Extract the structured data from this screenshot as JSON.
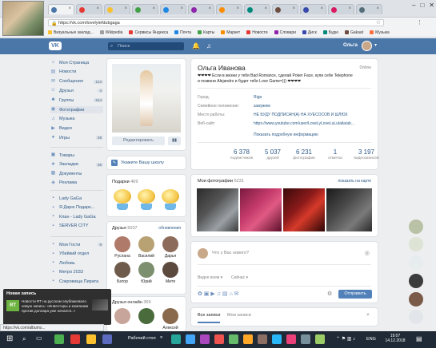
{
  "browser": {
    "tabs": [
      {
        "label": "",
        "color": "#4a76a8",
        "active": true
      },
      {
        "label": "",
        "color": "#e53935"
      },
      {
        "label": "",
        "color": "#fbc02d"
      },
      {
        "label": "",
        "color": "#43a047"
      },
      {
        "label": "",
        "color": "#1e88e5"
      },
      {
        "label": "",
        "color": "#8e24aa"
      },
      {
        "label": "",
        "color": "#fb8c00"
      },
      {
        "label": "",
        "color": "#00897b"
      },
      {
        "label": "",
        "color": "#6d4c41"
      },
      {
        "label": "",
        "color": "#3949ab"
      },
      {
        "label": "",
        "color": "#d81b60"
      },
      {
        "label": "",
        "color": "#546e7a"
      }
    ],
    "url": "https://vk.com/lovelylefdubgaga",
    "bookmarks": [
      "Визуальные заклад...",
      "Wikipedia",
      "Сервисы Яндекса",
      "Почта",
      "Карты",
      "Маркет",
      "Новости",
      "Словари",
      "Диск",
      "Будю",
      "Gakaat",
      "Музыка"
    ]
  },
  "vk": {
    "logo": "VK",
    "search_placeholder": "Поиск",
    "user_name": "Ольга",
    "menu": [
      {
        "label": "Моя Страница",
        "icon": "home-icon"
      },
      {
        "label": "Новости",
        "icon": "news-icon"
      },
      {
        "label": "Сообщения",
        "icon": "message-icon",
        "count": "144"
      },
      {
        "label": "Друзья",
        "icon": "friends-icon",
        "count": "4"
      },
      {
        "label": "Группы",
        "icon": "groups-icon",
        "count": "614"
      },
      {
        "label": "Фотографии",
        "icon": "photo-icon",
        "selected": true
      },
      {
        "label": "Музыка",
        "icon": "music-icon"
      },
      {
        "label": "Видео",
        "icon": "video-icon"
      },
      {
        "label": "Игры",
        "icon": "games-icon",
        "count": "29"
      }
    ],
    "menu2": [
      {
        "label": "Товары",
        "icon": "goods-icon"
      },
      {
        "label": "Закладки",
        "icon": "bookmark-icon",
        "count": "36"
      },
      {
        "label": "Документы",
        "icon": "document-icon"
      },
      {
        "label": "Реклама",
        "icon": "ads-icon"
      }
    ],
    "menu3": [
      {
        "label": "Lady GaGa"
      },
      {
        "label": "Я Дарю Подарк..."
      },
      {
        "label": "Клан - Lady GaGa"
      },
      {
        "label": "SERVER CITY"
      }
    ],
    "menu4": [
      {
        "label": "Мои Гости",
        "count": "9"
      },
      {
        "label": "Убийкий отдел"
      },
      {
        "label": "Любовь"
      },
      {
        "label": "Метро 2033"
      },
      {
        "label": "Сокровища Пирата"
      }
    ],
    "profile": {
      "name": "Ольга Иванова",
      "online": "Online",
      "status_line1": "❤❤❤❤ Если в жизни у тебя Bad Romance, сделай Poker Face, купи себе Telephone",
      "status_line2": "и позвони Alejandro и будет тебе Love Game=))) ❤❤❤❤",
      "fields": [
        {
          "label": "Город:",
          "value": "Riga"
        },
        {
          "label": "Семейное положение:",
          "value": "замужем"
        },
        {
          "label": "Место работы:",
          "value": "НЕ БУДУ ПОДПИСАН(А) НА ХУЕСОСОВ И ШЛЮХ"
        },
        {
          "label": "Веб-сайт:",
          "value": "https://www.youtube.com/user/LoveLyLoveLuLulaila/ab..."
        }
      ],
      "show_more": "Показать подробную информацию",
      "stats": [
        {
          "n": "6 378",
          "t": "подписчиков"
        },
        {
          "n": "5 037",
          "t": "друзей"
        },
        {
          "n": "6 231",
          "t": "фотографии"
        },
        {
          "n": "1",
          "t": "отметка"
        },
        {
          "n": "3 197",
          "t": "видеозаписей"
        }
      ]
    },
    "edit_button": "Редактировать",
    "stats_button": "",
    "school_prompt": "Укажите Вашу школу",
    "gifts_title": "Подарки",
    "gifts_count": "469",
    "friends_title": "Друзья",
    "friends_count": "5037",
    "friends_link": "обновления",
    "friends": [
      {
        "name": "Руслана",
        "color": "#b07a6a"
      },
      {
        "name": "Василий",
        "color": "#b8a173"
      },
      {
        "name": "Дарья",
        "color": "#8c6b5a"
      },
      {
        "name": "Батор",
        "color": "#6e5b4c"
      },
      {
        "name": "Юрий",
        "color": "#7c8f6e"
      },
      {
        "name": "Митя",
        "color": "#5d4a3f"
      }
    ],
    "friends_online_title": "Друзья онлайн",
    "friends_online_count": "369",
    "friends_online": [
      {
        "name": "",
        "color": "#c8a59a"
      },
      {
        "name": "",
        "color": "#4a6b3b"
      },
      {
        "name": "Алексей",
        "color": "#8a6a4c"
      }
    ],
    "my_photos_title": "Мои фотографии",
    "my_photos_count": "6231",
    "show_on_map": "показать на карте",
    "post_placeholder": "Что у Вас нового?",
    "visible_to": "Видно всем",
    "now": "Сейчас",
    "send_button": "Отправить",
    "wall_tabs": [
      "Все записи",
      "Мои записи"
    ]
  },
  "notification": {
    "title": "Новая запись",
    "badge": "RT",
    "text": "Новости RT на русском опубликовало новую запись: «Инвесторы и компании против доллара уже начался..»"
  },
  "status_bar_url": "https://vk.com/albums...",
  "taskbar": {
    "desktop_label": "Рабочий стол",
    "lang": "ENG",
    "time": "19:07",
    "date": "14.12.2018"
  }
}
